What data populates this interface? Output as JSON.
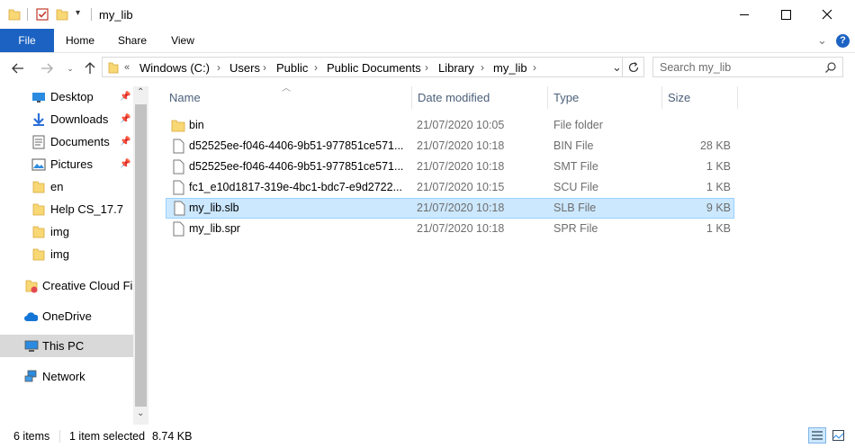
{
  "window": {
    "title": "my_lib"
  },
  "ribbon": {
    "tabs": [
      {
        "label": "File"
      },
      {
        "label": "Home"
      },
      {
        "label": "Share"
      },
      {
        "label": "View"
      }
    ]
  },
  "address": {
    "root_marker": "«",
    "crumbs": [
      "Windows (C:)",
      "Users",
      "Public",
      "Public Documents",
      "Library",
      "my_lib"
    ]
  },
  "search": {
    "placeholder": "Search my_lib"
  },
  "nav": {
    "quick_access": [
      {
        "label": "Desktop",
        "icon": "desktop-icon",
        "pinned": true
      },
      {
        "label": "Downloads",
        "icon": "download-icon",
        "pinned": true
      },
      {
        "label": "Documents",
        "icon": "documents-icon",
        "pinned": true
      },
      {
        "label": "Pictures",
        "icon": "pictures-icon",
        "pinned": true
      },
      {
        "label": "en",
        "icon": "folder-icon"
      },
      {
        "label": "Help CS_17.7",
        "icon": "folder-icon"
      },
      {
        "label": "img",
        "icon": "folder-icon"
      },
      {
        "label": "img",
        "icon": "folder-icon"
      }
    ],
    "creative_cloud": "Creative Cloud Files",
    "onedrive": "OneDrive",
    "this_pc": "This PC",
    "network": "Network"
  },
  "columns": {
    "name": "Name",
    "date": "Date modified",
    "type": "Type",
    "size": "Size"
  },
  "files": [
    {
      "name": "bin",
      "date": "21/07/2020 10:05",
      "type": "File folder",
      "size": "",
      "icon": "folder-icon"
    },
    {
      "name": "d52525ee-f046-4406-9b51-977851ce571...",
      "date": "21/07/2020 10:18",
      "type": "BIN File",
      "size": "28 KB",
      "icon": "file-icon"
    },
    {
      "name": "d52525ee-f046-4406-9b51-977851ce571...",
      "date": "21/07/2020 10:18",
      "type": "SMT File",
      "size": "1 KB",
      "icon": "file-icon"
    },
    {
      "name": "fc1_e10d1817-319e-4bc1-bdc7-e9d2722...",
      "date": "21/07/2020 10:15",
      "type": "SCU File",
      "size": "1 KB",
      "icon": "file-icon"
    },
    {
      "name": "my_lib.slb",
      "date": "21/07/2020 10:18",
      "type": "SLB File",
      "size": "9 KB",
      "icon": "file-icon",
      "selected": true
    },
    {
      "name": "my_lib.spr",
      "date": "21/07/2020 10:18",
      "type": "SPR File",
      "size": "1 KB",
      "icon": "file-icon"
    }
  ],
  "status": {
    "items": "6 items",
    "selected": "1 item selected",
    "size": "8.74 KB"
  },
  "colors": {
    "accent": "#1b62c2",
    "selection": "#cce8ff",
    "folder": "#f8d775"
  }
}
